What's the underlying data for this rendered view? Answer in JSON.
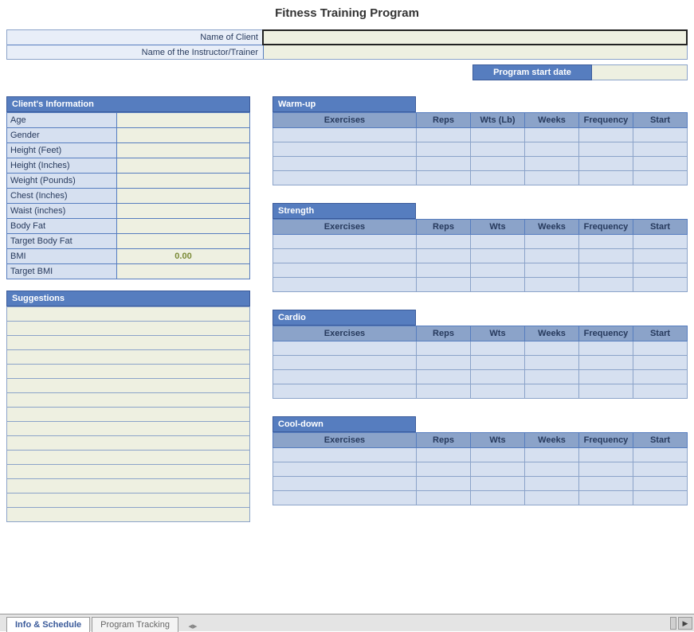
{
  "title": "Fitness Training Program",
  "header": {
    "name_label": "Name of Client",
    "name_value": "",
    "trainer_label": "Name of the Instructor/Trainer",
    "trainer_value": ""
  },
  "start_date": {
    "label": "Program start date",
    "value": ""
  },
  "client_info": {
    "heading": "Client's Information",
    "rows": [
      {
        "label": "Age",
        "value": ""
      },
      {
        "label": "Gender",
        "value": ""
      },
      {
        "label": "Height (Feet)",
        "value": ""
      },
      {
        "label": "Height (Inches)",
        "value": ""
      },
      {
        "label": "Weight (Pounds)",
        "value": ""
      },
      {
        "label": "Chest (Inches)",
        "value": ""
      },
      {
        "label": "Waist (inches)",
        "value": ""
      },
      {
        "label": "Body Fat",
        "value": ""
      },
      {
        "label": "Target Body Fat",
        "value": ""
      },
      {
        "label": "BMI",
        "value": "0.00",
        "is_bmi": true
      },
      {
        "label": "Target BMI",
        "value": ""
      }
    ]
  },
  "suggestions": {
    "heading": "Suggestions",
    "row_count": 15
  },
  "exercise_sections": [
    {
      "heading": "Warm-up",
      "columns": [
        "Exercises",
        "Reps",
        "Wts (Lb)",
        "Weeks",
        "Frequency",
        "Start"
      ],
      "row_count": 4
    },
    {
      "heading": "Strength",
      "columns": [
        "Exercises",
        "Reps",
        "Wts",
        "Weeks",
        "Frequency",
        "Start"
      ],
      "row_count": 4
    },
    {
      "heading": "Cardio",
      "columns": [
        "Exercises",
        "Reps",
        "Wts",
        "Weeks",
        "Frequency",
        "Start"
      ],
      "row_count": 4
    },
    {
      "heading": "Cool-down",
      "columns": [
        "Exercises",
        "Reps",
        "Wts",
        "Weeks",
        "Frequency",
        "Start"
      ],
      "row_count": 4
    }
  ],
  "tabs": {
    "active": "Info & Schedule",
    "other": "Program Tracking"
  }
}
